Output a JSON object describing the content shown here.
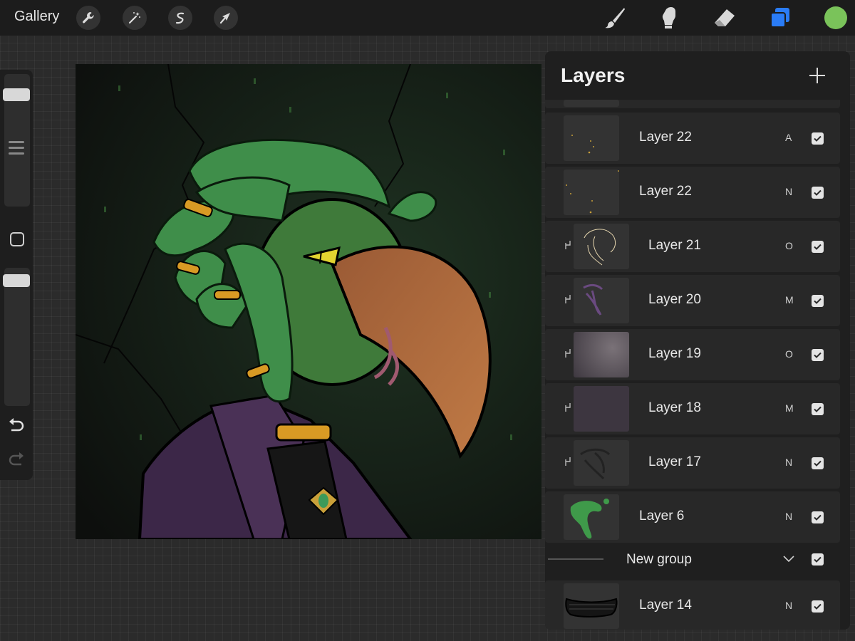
{
  "topbar": {
    "gallery_label": "Gallery",
    "left_tools": [
      "wrench-icon",
      "magic-wand-icon",
      "selection-icon",
      "transform-arrow-icon"
    ],
    "right_tools": [
      "brush-icon",
      "smudge-icon",
      "eraser-icon",
      "layers-icon"
    ],
    "active_color": "#7ac35a",
    "accent_color": "#2a7cf6"
  },
  "sidebar": {
    "brush_size_level": 0.12,
    "opacity_level": 0.05
  },
  "layers": {
    "title": "Layers",
    "items": [
      {
        "name": "Layer 22",
        "blend": "A",
        "clipped": false,
        "visible": true
      },
      {
        "name": "Layer 22",
        "blend": "N",
        "clipped": false,
        "visible": true
      },
      {
        "name": "Layer 21",
        "blend": "O",
        "clipped": true,
        "visible": true
      },
      {
        "name": "Layer 20",
        "blend": "M",
        "clipped": true,
        "visible": true
      },
      {
        "name": "Layer 19",
        "blend": "O",
        "clipped": true,
        "visible": true
      },
      {
        "name": "Layer 18",
        "blend": "M",
        "clipped": true,
        "visible": true
      },
      {
        "name": "Layer 17",
        "blend": "N",
        "clipped": true,
        "visible": true
      },
      {
        "name": "Layer 6",
        "blend": "N",
        "clipped": false,
        "visible": true
      }
    ],
    "group": {
      "name": "New group",
      "visible": true
    },
    "group_items": [
      {
        "name": "Layer 14",
        "blend": "N",
        "clipped": false,
        "visible": true
      }
    ]
  }
}
